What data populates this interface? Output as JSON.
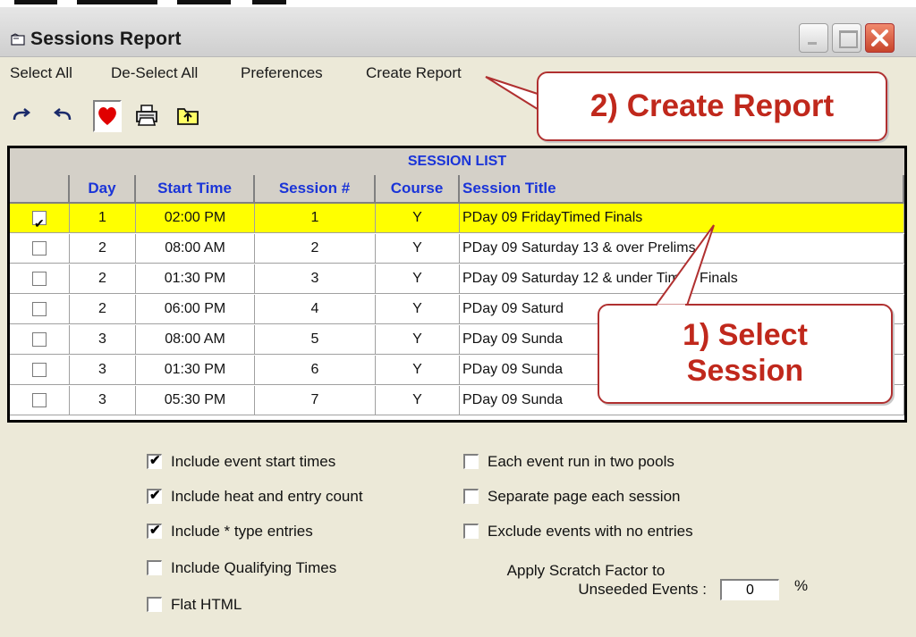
{
  "window": {
    "title": "Sessions Report"
  },
  "menu": [
    "Select All",
    "De-Select All",
    "Preferences",
    "Create Report"
  ],
  "toolbar": [
    {
      "icon": "redo-arrow-icon"
    },
    {
      "icon": "undo-arrow-icon"
    },
    {
      "icon": "heart-icon"
    },
    {
      "icon": "printer-icon"
    },
    {
      "icon": "folder-up-icon"
    }
  ],
  "callouts": {
    "create_report": "2) Create Report",
    "select_line1": "1) Select",
    "select_line2": "Session"
  },
  "grid": {
    "title": "SESSION LIST",
    "columns": [
      "",
      "Day",
      "Start Time",
      "Session #",
      "Course",
      "Session Title"
    ],
    "rows": [
      {
        "checked": true,
        "day": "1",
        "start": "02:00 PM",
        "session": "1",
        "course": "Y",
        "title": "PDay 09 FridayTimed Finals"
      },
      {
        "checked": false,
        "day": "2",
        "start": "08:00 AM",
        "session": "2",
        "course": "Y",
        "title": "PDay 09 Saturday 13 & over Prelims"
      },
      {
        "checked": false,
        "day": "2",
        "start": "01:30 PM",
        "session": "3",
        "course": "Y",
        "title": "PDay 09 Saturday 12 & under Timed Finals"
      },
      {
        "checked": false,
        "day": "2",
        "start": "06:00 PM",
        "session": "4",
        "course": "Y",
        "title": "PDay 09 Saturd"
      },
      {
        "checked": false,
        "day": "3",
        "start": "08:00 AM",
        "session": "5",
        "course": "Y",
        "title": "PDay 09 Sunda"
      },
      {
        "checked": false,
        "day": "3",
        "start": "01:30 PM",
        "session": "6",
        "course": "Y",
        "title": "PDay 09 Sunda"
      },
      {
        "checked": false,
        "day": "3",
        "start": "05:30 PM",
        "session": "7",
        "course": "Y",
        "title": "PDay 09 Sunda"
      }
    ]
  },
  "options_left": [
    {
      "label": "Include event start times",
      "checked": true
    },
    {
      "label": "Include heat and entry count",
      "checked": true
    },
    {
      "label": "Include * type entries",
      "checked": true
    },
    {
      "label": "Include Qualifying Times",
      "checked": false
    },
    {
      "label": "Flat HTML",
      "checked": false
    }
  ],
  "options_right": [
    {
      "label": "Each event run in two pools",
      "checked": false
    },
    {
      "label": "Separate page each session",
      "checked": false
    },
    {
      "label": "Exclude events with no entries",
      "checked": false
    }
  ],
  "scratch": {
    "label_line1": "Apply Scratch Factor to",
    "label_line2": "Unseeded Events :",
    "value": "0",
    "unit": "%"
  },
  "colors": {
    "header_text": "#1a34d8",
    "selected_row": "#ffff00",
    "callout_text": "#c0281c"
  }
}
